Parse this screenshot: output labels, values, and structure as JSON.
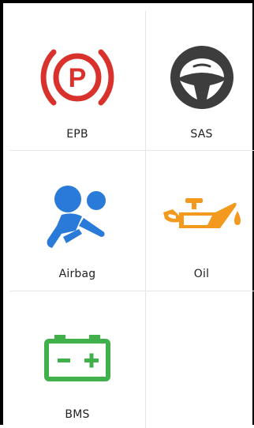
{
  "tiles": [
    {
      "label": "EPB",
      "icon": "parking-brake-icon",
      "color": "#d9322c"
    },
    {
      "label": "SAS",
      "icon": "steering-wheel-icon",
      "color": "#3d3d3d"
    },
    {
      "label": "Airbag",
      "icon": "airbag-icon",
      "color": "#2a7bd9"
    },
    {
      "label": "Oil",
      "icon": "oil-can-icon",
      "color": "#f39a1e"
    },
    {
      "label": "BMS",
      "icon": "battery-icon",
      "color": "#3fb04a"
    }
  ]
}
